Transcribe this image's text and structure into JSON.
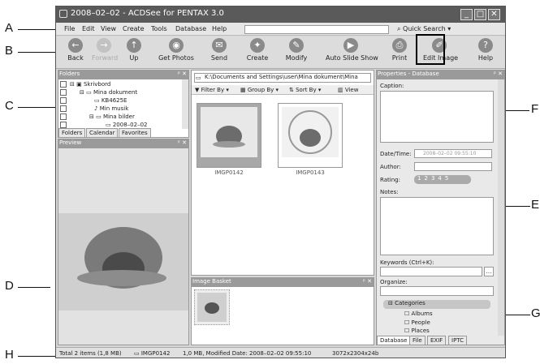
{
  "callouts": [
    "A",
    "B",
    "C",
    "D",
    "E",
    "F",
    "G",
    "H"
  ],
  "window": {
    "title": "2008–02–02 - ACDSee for PENTAX 3.0",
    "buttons": [
      "_",
      "□",
      "✕"
    ]
  },
  "menu": [
    "File",
    "Edit",
    "View",
    "Create",
    "Tools",
    "Database",
    "Help"
  ],
  "quick_search": "Quick Search",
  "toolbar": [
    {
      "label": "Back",
      "icon": "back-arrow-icon",
      "disabled": false
    },
    {
      "label": "Forward",
      "icon": "forward-arrow-icon",
      "disabled": true
    },
    {
      "label": "Up",
      "icon": "up-arrow-icon",
      "disabled": false
    },
    {
      "label": "Get Photos",
      "icon": "camera-icon",
      "disabled": false
    },
    {
      "label": "Send",
      "icon": "send-icon",
      "disabled": false
    },
    {
      "label": "Create",
      "icon": "wand-icon",
      "disabled": false
    },
    {
      "label": "Modify",
      "icon": "modify-icon",
      "disabled": false
    },
    {
      "label": "Auto Slide Show",
      "icon": "slideshow-icon",
      "disabled": false
    },
    {
      "label": "Print",
      "icon": "printer-icon",
      "disabled": false
    },
    {
      "label": "Edit Image",
      "icon": "edit-image-icon",
      "disabled": false
    },
    {
      "label": "Help",
      "icon": "help-icon",
      "disabled": false
    }
  ],
  "folders": {
    "header": "Folders",
    "tree": [
      "Skrivbord",
      "Mina dokument",
      "KB4625E",
      "Min musik",
      "Mina bilder",
      "2008–02–02"
    ],
    "tabs": [
      "Folders",
      "Calendar",
      "Favorites"
    ]
  },
  "preview": {
    "header": "Preview"
  },
  "browser": {
    "path": "K:\\Documents and Settings\\user\\Mina dokument\\Mina",
    "filter": "Filter By",
    "group": "Group By",
    "sort": "Sort By",
    "view": "View",
    "thumbs": [
      "IMGP0142",
      "IMGP0143"
    ]
  },
  "basket": {
    "header": "Image Basket"
  },
  "properties": {
    "header": "Properties - Database",
    "caption": "Caption:",
    "datetime_label": "Date/Time:",
    "datetime_value": "2008–02–02 09:55:10",
    "author": "Author:",
    "rating": "Rating:",
    "rating_values": [
      "1",
      "2",
      "3",
      "4",
      "5"
    ],
    "notes": "Notes:",
    "keywords": "Keywords (Ctrl+K):",
    "organize": "Organize:",
    "categories": "Categories",
    "category_items": [
      "Albums",
      "People",
      "Places"
    ],
    "tabs": [
      "Database",
      "File",
      "EXIF",
      "IPTC"
    ]
  },
  "status": {
    "total": "Total 2 items (1,8 MB)",
    "file": "IMGP0142",
    "info": "1,0 MB, Modified Date: 2008–02–02 09:55:10",
    "dims": "3072x2304x24b"
  }
}
